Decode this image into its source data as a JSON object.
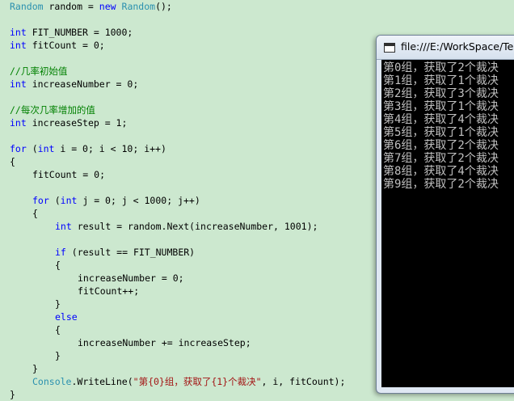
{
  "editor": {
    "lines": [
      {
        "y": 0,
        "indent": 0,
        "tokens": [
          {
            "t": "Random",
            "c": "type"
          },
          {
            "t": " random = ",
            "c": "plain"
          },
          {
            "t": "new",
            "c": "kw"
          },
          {
            "t": " ",
            "c": "plain"
          },
          {
            "t": "Random",
            "c": "type"
          },
          {
            "t": "();",
            "c": "plain"
          }
        ]
      },
      {
        "y": 2,
        "indent": 0,
        "tokens": [
          {
            "t": "int",
            "c": "kw"
          },
          {
            "t": " FIT_NUMBER = 1000;",
            "c": "plain"
          }
        ]
      },
      {
        "y": 3,
        "indent": 0,
        "tokens": [
          {
            "t": "int",
            "c": "kw"
          },
          {
            "t": " fitCount = 0;",
            "c": "plain"
          }
        ]
      },
      {
        "y": 5,
        "indent": 0,
        "tokens": [
          {
            "t": "//几率初始值",
            "c": "cm"
          }
        ]
      },
      {
        "y": 6,
        "indent": 0,
        "tokens": [
          {
            "t": "int",
            "c": "kw"
          },
          {
            "t": " increaseNumber = 0;",
            "c": "plain"
          }
        ]
      },
      {
        "y": 8,
        "indent": 0,
        "tokens": [
          {
            "t": "//每次几率增加的值",
            "c": "cm"
          }
        ]
      },
      {
        "y": 9,
        "indent": 0,
        "tokens": [
          {
            "t": "int",
            "c": "kw"
          },
          {
            "t": " increaseStep = 1;",
            "c": "plain"
          }
        ]
      },
      {
        "y": 11,
        "indent": 0,
        "tokens": [
          {
            "t": "for",
            "c": "kw"
          },
          {
            "t": " (",
            "c": "plain"
          },
          {
            "t": "int",
            "c": "kw"
          },
          {
            "t": " i = 0; i < 10; i++)",
            "c": "plain"
          }
        ]
      },
      {
        "y": 12,
        "indent": 0,
        "tokens": [
          {
            "t": "{",
            "c": "plain"
          }
        ]
      },
      {
        "y": 13,
        "indent": 1,
        "tokens": [
          {
            "t": "fitCount = 0;",
            "c": "plain"
          }
        ]
      },
      {
        "y": 15,
        "indent": 1,
        "tokens": [
          {
            "t": "for",
            "c": "kw"
          },
          {
            "t": " (",
            "c": "plain"
          },
          {
            "t": "int",
            "c": "kw"
          },
          {
            "t": " j = 0; j < 1000; j++)",
            "c": "plain"
          }
        ]
      },
      {
        "y": 16,
        "indent": 1,
        "tokens": [
          {
            "t": "{",
            "c": "plain"
          }
        ]
      },
      {
        "y": 17,
        "indent": 2,
        "tokens": [
          {
            "t": "int",
            "c": "kw"
          },
          {
            "t": " result = random.Next(increaseNumber, 1001);",
            "c": "plain"
          }
        ]
      },
      {
        "y": 19,
        "indent": 2,
        "tokens": [
          {
            "t": "if",
            "c": "kw"
          },
          {
            "t": " (result == FIT_NUMBER)",
            "c": "plain"
          }
        ]
      },
      {
        "y": 20,
        "indent": 2,
        "tokens": [
          {
            "t": "{",
            "c": "plain"
          }
        ]
      },
      {
        "y": 21,
        "indent": 3,
        "tokens": [
          {
            "t": "increaseNumber = 0;",
            "c": "plain"
          }
        ]
      },
      {
        "y": 22,
        "indent": 3,
        "tokens": [
          {
            "t": "fitCount++;",
            "c": "plain"
          }
        ]
      },
      {
        "y": 23,
        "indent": 2,
        "tokens": [
          {
            "t": "}",
            "c": "plain"
          }
        ]
      },
      {
        "y": 24,
        "indent": 2,
        "tokens": [
          {
            "t": "else",
            "c": "kw"
          }
        ]
      },
      {
        "y": 25,
        "indent": 2,
        "tokens": [
          {
            "t": "{",
            "c": "plain"
          }
        ]
      },
      {
        "y": 26,
        "indent": 3,
        "tokens": [
          {
            "t": "increaseNumber += increaseStep;",
            "c": "plain"
          }
        ]
      },
      {
        "y": 27,
        "indent": 2,
        "tokens": [
          {
            "t": "}",
            "c": "plain"
          }
        ]
      },
      {
        "y": 28,
        "indent": 1,
        "tokens": [
          {
            "t": "}",
            "c": "plain"
          }
        ]
      },
      {
        "y": 29,
        "indent": 1,
        "tokens": [
          {
            "t": "Console",
            "c": "type"
          },
          {
            "t": ".WriteLine(",
            "c": "plain"
          },
          {
            "t": "\"第{0}组，获取了{1}个裁决\"",
            "c": "str"
          },
          {
            "t": ", i, fitCount);",
            "c": "plain"
          }
        ]
      },
      {
        "y": 30,
        "indent": 0,
        "tokens": [
          {
            "t": "}",
            "c": "plain"
          }
        ]
      }
    ]
  },
  "console": {
    "title": "file:///E:/WorkSpace/Tes",
    "icon": "console-window-icon",
    "lines": [
      "第0组，获取了2个裁决",
      "第1组，获取了1个裁决",
      "第2组，获取了3个裁决",
      "第3组，获取了1个裁决",
      "第4组，获取了4个裁决",
      "第5组，获取了1个裁决",
      "第6组，获取了2个裁决",
      "第7组，获取了2个裁决",
      "第8组，获取了4个裁决",
      "第9组，获取了2个裁决"
    ]
  },
  "colors": {
    "editor_background": "#cce8cf",
    "keyword": "#0000ff",
    "type": "#2b91af",
    "comment": "#008000",
    "string": "#a31515",
    "console_background": "#000000",
    "console_text": "#c0c0c0"
  }
}
